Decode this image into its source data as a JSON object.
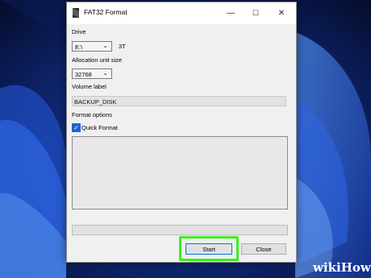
{
  "window": {
    "title": "FAT32 Format",
    "minimize_glyph": "—",
    "maximize_glyph": "☐",
    "close_glyph": "✕"
  },
  "drive": {
    "label": "Drive",
    "selected": "E:\\",
    "capacity": "3T"
  },
  "allocation": {
    "label": "Allocation unit size",
    "selected": "32768"
  },
  "volume": {
    "label": "Volume label",
    "value": "BACKUP_DISK"
  },
  "format_options": {
    "label": "Format options",
    "quick_format_label": "Quick Format",
    "quick_format_checked": true
  },
  "progress": {
    "value_percent": 0
  },
  "buttons": {
    "start_label": "Start",
    "close_label": "Close"
  },
  "watermark": "wikiHow",
  "icons": {
    "app": "fat32-app-icon",
    "dropdown": "chevron-down-icon",
    "checkbox": "checkmark-icon"
  },
  "colors": {
    "highlight": "#3cee1e",
    "checkbox": "#1e64d1",
    "accent": "#0078d4"
  }
}
